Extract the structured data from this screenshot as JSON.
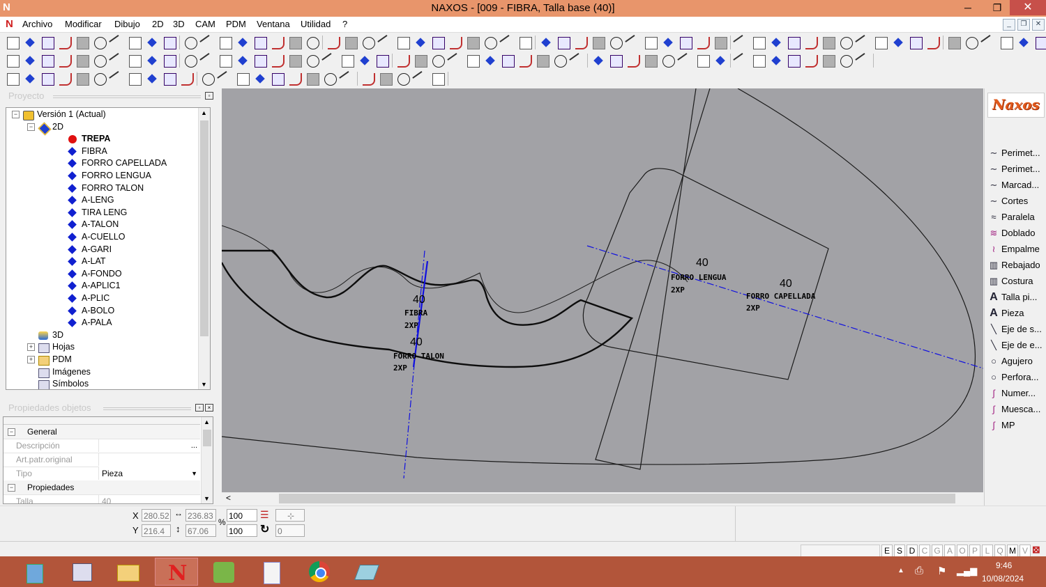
{
  "window": {
    "title": "NAXOS - [009 - FIBRA, Talla base (40)]",
    "app_icon": "N",
    "minimize_glyph": "─",
    "maximize_glyph": "❐",
    "close_glyph": "✕"
  },
  "menubar": {
    "items": [
      "Archivo",
      "Modificar",
      "Dibujo",
      "2D",
      "3D",
      "CAM",
      "PDM",
      "Ventana",
      "Utilidad",
      "?"
    ],
    "mdi_buttons": [
      "_",
      "❐",
      "✕"
    ]
  },
  "project_panel": {
    "title": "Proyecto",
    "tree": [
      {
        "label": "Versión 1 (Actual)",
        "level": 0,
        "icon": "version-icon",
        "expander": "−"
      },
      {
        "label": "2D",
        "level": 1,
        "icon": "2d-icon",
        "expander": "−"
      },
      {
        "label": "TREPA",
        "level": 2,
        "icon": "red-dot-icon",
        "bold": true
      },
      {
        "label": "FIBRA",
        "level": 2,
        "icon": "diamond-icon"
      },
      {
        "label": "FORRO CAPELLADA",
        "level": 2,
        "icon": "diamond-icon"
      },
      {
        "label": "FORRO LENGUA",
        "level": 2,
        "icon": "diamond-icon"
      },
      {
        "label": "FORRO TALON",
        "level": 2,
        "icon": "diamond-icon"
      },
      {
        "label": "A-LENG",
        "level": 2,
        "icon": "diamond-icon"
      },
      {
        "label": "TIRA LENG",
        "level": 2,
        "icon": "diamond-icon"
      },
      {
        "label": "A-TALON",
        "level": 2,
        "icon": "diamond-icon"
      },
      {
        "label": "A-CUELLO",
        "level": 2,
        "icon": "diamond-icon"
      },
      {
        "label": "A-GARI",
        "level": 2,
        "icon": "diamond-icon"
      },
      {
        "label": "A-LAT",
        "level": 2,
        "icon": "diamond-icon"
      },
      {
        "label": "A-FONDO",
        "level": 2,
        "icon": "diamond-icon"
      },
      {
        "label": "A-APLIC1",
        "level": 2,
        "icon": "diamond-icon"
      },
      {
        "label": "A-PLIC",
        "level": 2,
        "icon": "diamond-icon"
      },
      {
        "label": "A-BOLO",
        "level": 2,
        "icon": "diamond-icon"
      },
      {
        "label": "A-PALA",
        "level": 2,
        "icon": "diamond-icon"
      },
      {
        "label": "3D",
        "level": 1,
        "icon": "3d-icon"
      },
      {
        "label": "Hojas",
        "level": 1,
        "icon": "sheets-icon",
        "expander": "+"
      },
      {
        "label": "PDM",
        "level": 1,
        "icon": "folder-icon",
        "expander": "+"
      },
      {
        "label": "Imágenes",
        "level": 1,
        "icon": "image-icon"
      },
      {
        "label": "Símbolos",
        "level": 1,
        "icon": "symbols-icon"
      }
    ]
  },
  "properties_panel": {
    "title": "Propiedades objetos",
    "rows": [
      {
        "type": "category",
        "label": "General",
        "expander": "−"
      },
      {
        "type": "field",
        "label": "Descripción",
        "value": "",
        "button": "..."
      },
      {
        "type": "field",
        "label": "Art.patr.original",
        "value": ""
      },
      {
        "type": "field",
        "label": "Tipo",
        "value": "Pieza",
        "dropdown": true
      },
      {
        "type": "category",
        "label": "Propiedades",
        "expander": "−"
      },
      {
        "type": "field",
        "label": "Talla",
        "value": "40"
      }
    ]
  },
  "canvas": {
    "labels": [
      {
        "size": "40",
        "name": "FIBRA",
        "qty": "2XP"
      },
      {
        "size": "40",
        "name": "FORRO TALON",
        "qty": "2XP"
      },
      {
        "size": "40",
        "name": "FORRO LENGUA",
        "qty": "2XP"
      },
      {
        "size": "40",
        "name": "FORRO CAPELLADA",
        "qty": "2XP"
      }
    ],
    "scroll_left_glyph": "<"
  },
  "right_panel": {
    "logo": "Naxos",
    "items": [
      {
        "label": "Perimet...",
        "icon": "curve-icon"
      },
      {
        "label": "Perimet...",
        "icon": "curve-icon"
      },
      {
        "label": "Marcad...",
        "icon": "curve-icon"
      },
      {
        "label": "Cortes",
        "icon": "curve-icon"
      },
      {
        "label": "Paralela",
        "icon": "parallel-icon"
      },
      {
        "label": "Doblado",
        "icon": "fold-icon"
      },
      {
        "label": "Empalme",
        "icon": "join-icon"
      },
      {
        "label": "Rebajado",
        "icon": "skive-icon"
      },
      {
        "label": "Costura",
        "icon": "seam-icon"
      },
      {
        "label": "Talla pi...",
        "icon": "text-a-icon"
      },
      {
        "label": "Pieza",
        "icon": "text-a-icon"
      },
      {
        "label": "Eje de s...",
        "icon": "axis-icon"
      },
      {
        "label": "Eje de e...",
        "icon": "axis-icon"
      },
      {
        "label": "Agujero",
        "icon": "circle-icon"
      },
      {
        "label": "Perfora...",
        "icon": "circle-icon"
      },
      {
        "label": "Numer...",
        "icon": "pen-icon"
      },
      {
        "label": "Muesca...",
        "icon": "pen-icon"
      },
      {
        "label": "MP",
        "icon": "pen-icon"
      }
    ]
  },
  "coordbar": {
    "x_label": "X",
    "y_label": "Y",
    "x": "280.52",
    "y": "216.4",
    "width_value": "236.83",
    "height_value": "67.06",
    "percent_label": "%",
    "scale_x": "100",
    "scale_y": "100",
    "rotation": "0"
  },
  "statusbar": {
    "toggles": [
      "E",
      "S",
      "D",
      "C",
      "G",
      "A",
      "O",
      "P",
      "L",
      "Q",
      "M",
      "V"
    ],
    "active": [
      "E",
      "S",
      "D",
      "M"
    ]
  },
  "taskbar": {
    "time": "9:46",
    "date": "10/08/2024"
  },
  "colors": {
    "titlebar": "#e8956b",
    "canvas_bg": "#a2a2a6",
    "taskbar": "#b2553a",
    "axis_blue": "#1010e0"
  }
}
